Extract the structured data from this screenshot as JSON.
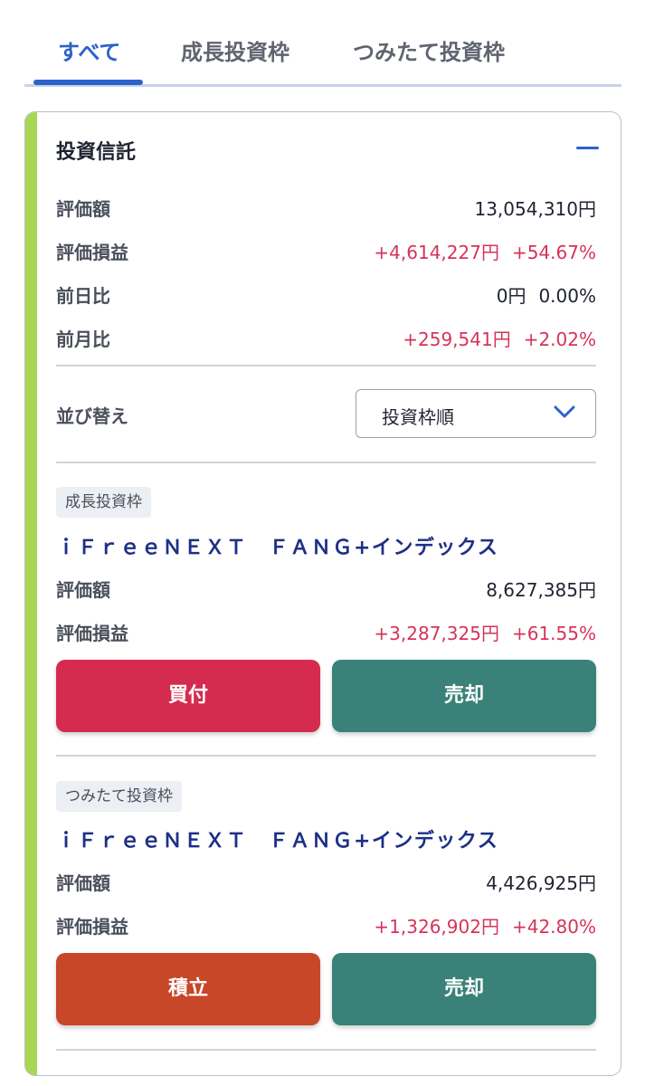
{
  "tabs": [
    {
      "label": "すべて",
      "active": true
    },
    {
      "label": "成長投資枠",
      "active": false
    },
    {
      "label": "つみたて投資枠",
      "active": false
    }
  ],
  "summary": {
    "title": "投資信託",
    "rows": [
      {
        "label": "評価額",
        "amount": "13,054,310円",
        "percent": ""
      },
      {
        "label": "評価損益",
        "amount": "+4,614,227円",
        "percent": "+54.67%"
      },
      {
        "label": "前日比",
        "amount": "0円",
        "percent": "0.00%"
      },
      {
        "label": "前月比",
        "amount": "+259,541円",
        "percent": "+2.02%"
      }
    ]
  },
  "sort": {
    "label": "並び替え",
    "selected": "投資枠順"
  },
  "funds": [
    {
      "badge": "成長投資枠",
      "name": "ｉＦｒｅｅＮＥＸＴ　ＦＡＮＧ+インデックス",
      "value_label": "評価額",
      "value": "8,627,385円",
      "pl_label": "評価損益",
      "pl_amount": "+3,287,325円",
      "pl_percent": "+61.55%",
      "primary_button": "買付",
      "sell_button": "売却"
    },
    {
      "badge": "つみたて投資枠",
      "name": "ｉＦｒｅｅＮＥＸＴ　ＦＡＮＧ+インデックス",
      "value_label": "評価額",
      "value": "4,426,925円",
      "pl_label": "評価損益",
      "pl_amount": "+1,326,902円",
      "pl_percent": "+42.80%",
      "primary_button": "積立",
      "sell_button": "売却"
    }
  ],
  "colors": {
    "accent_blue": "#2b62c9",
    "positive_red": "#d6335a",
    "buy_button": "#d52b4e",
    "accumulate_button": "#c84728",
    "sell_button": "#3a8279",
    "card_accent_green": "#a9d653",
    "fund_name_navy": "#1d2f86"
  },
  "icons": {
    "collapse": "minus-icon",
    "sort_dropdown": "chevron-down-icon"
  }
}
